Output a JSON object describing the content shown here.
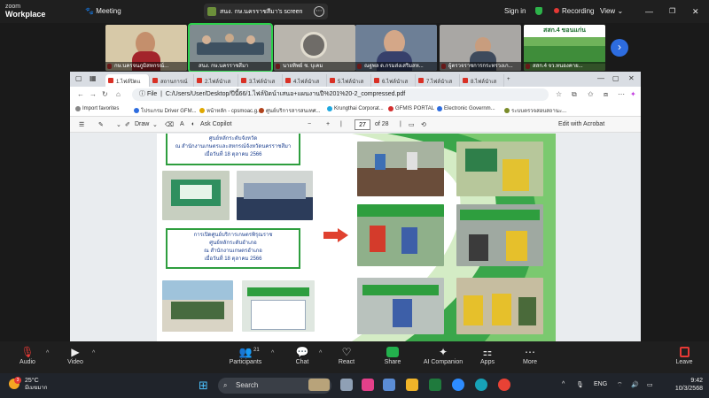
{
  "zoom": {
    "logo_top": "zoom",
    "logo_bottom": "Workplace",
    "meeting_label": "Meeting",
    "share_title": "สนง. กษ.นครราชสีมา's screen",
    "sign_in": "Sign in",
    "recording": "Recording",
    "view": "View"
  },
  "participants": [
    {
      "name": "กษ.นครจนภูมิสหกรณ์..."
    },
    {
      "name": "สนง. กษ.นครราชสีมา"
    },
    {
      "name": "นายทิพย์ ช. บุเคม"
    },
    {
      "name": "ณฐพล ด.กรมส่งเสริมสห..."
    },
    {
      "name": "ผู้ตรวจราชการกระทรวงเก..."
    },
    {
      "name": "สสก.4 จว.หนองคาย..."
    }
  ],
  "tile_banner": "สสก.4 ขอนแก่น",
  "browser": {
    "tabs": [
      "1.ไฟล์ปิดแ",
      "สถานการณ์",
      "2.ไฟล์นำเส",
      "3.ไฟล์นำเส",
      "4.ไฟล์นำเส",
      "5.ไฟล์นำเส",
      "6.ไฟล์นำเส",
      "7.ไฟล์นำเส",
      "8.ไฟล์นำเส"
    ],
    "new_tab": "+",
    "file_label": "File",
    "url": "C:/Users/User/Desktop/ปีนี้66/1.ไฟล์ปิดน์าเสนอ+แผนงานปี%201%20-2_compressed.pdf",
    "bookmarks": [
      "Import favorites",
      "โปรแกรม Driver GFM...",
      "หน้าหลัก - cpsmoac.g...",
      "ศูนย์บริการสารสนเทศ...",
      "Krungthai Corporat...",
      "GFMIS PORTAL",
      "Electronic Governm...",
      "ระบบตรวจสอบสถานะ..."
    ]
  },
  "pdf_toolbar": {
    "draw": "Draw",
    "ask_copilot": "Ask Copilot",
    "minus": "−",
    "plus": "+",
    "page_current": "27",
    "page_total": "of 28",
    "edit_acrobat": "Edit with Acrobat"
  },
  "pdf_page": {
    "box1_line1": "ศูนย์หลักระดับจังหวัด",
    "box1_line2": "ณ สำนักงานเกษตรและสหกรณ์จังหวัดนครราชสีมา",
    "box1_line3": "เมื่อวันที่ 18 ตุลาคม 2566",
    "box2_line1": "การเปิดศูนย์บริการเกษตรพิรุณราช",
    "box2_line2": "ศูนย์หลักระดับอำเภอ",
    "box2_line3": "ณ สำนักงานเกษตรอำเภอ",
    "box2_line4": "เมื่อวันที่ 18 ตุลาคม 2566"
  },
  "controls": {
    "audio": "Audio",
    "video": "Video",
    "participants": "Participants",
    "participants_count": "21",
    "chat": "Chat",
    "react": "React",
    "share": "Share",
    "ai_companion": "AI Companion",
    "apps": "Apps",
    "more": "More",
    "leave": "Leave"
  },
  "taskbar": {
    "temperature": "25°C",
    "weather_desc": "มีเมฆมาก",
    "weather_badge": "3",
    "search": "Search",
    "language": "ENG",
    "time": "9:42",
    "date": "10/3/2568"
  },
  "colors": {
    "zoom_bg": "#1f1f1f",
    "accent_green": "#2e9e3e",
    "recording_red": "#e53935",
    "next_blue": "#2d6cdf"
  }
}
